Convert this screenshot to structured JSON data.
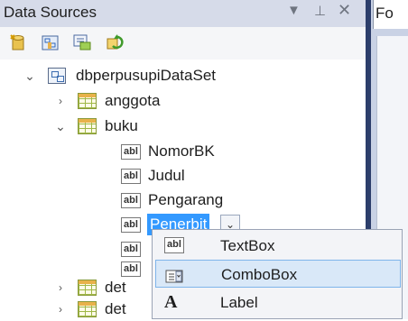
{
  "panel": {
    "title": "Data Sources",
    "pin_glyph": "▾ ⊥ ✕",
    "right_tab_label": "Fo"
  },
  "toolbar": {
    "buttons": [
      "add-data-source-icon",
      "edit-dataset-icon",
      "configure-icon",
      "refresh-icon"
    ]
  },
  "tree": {
    "root": {
      "label": "dbperpusupiDataSet",
      "expanded": true
    },
    "tables": [
      {
        "label": "anggota",
        "expanded": false
      },
      {
        "label": "buku",
        "expanded": true
      },
      {
        "label": "det",
        "expanded": false
      },
      {
        "label": "det",
        "expanded": false
      }
    ],
    "fields": [
      {
        "label": "NomorBK",
        "icon": "abl"
      },
      {
        "label": "Judul",
        "icon": "abl"
      },
      {
        "label": "Pengarang",
        "icon": "abl"
      },
      {
        "label": "Penerbit",
        "icon": "abl",
        "selected": true
      },
      {
        "label": "",
        "icon": "abl"
      },
      {
        "label": "",
        "icon": "abl"
      }
    ]
  },
  "dropdown": {
    "items": [
      {
        "label": "TextBox",
        "icon": "abl"
      },
      {
        "label": "ComboBox",
        "icon": "combobox-icon",
        "highlighted": true
      },
      {
        "label": "Label",
        "icon": "A"
      }
    ]
  },
  "colors": {
    "selection": "#3399ff",
    "menu_hover": "#d9e8f8",
    "titlebar": "#d6dbe9"
  }
}
